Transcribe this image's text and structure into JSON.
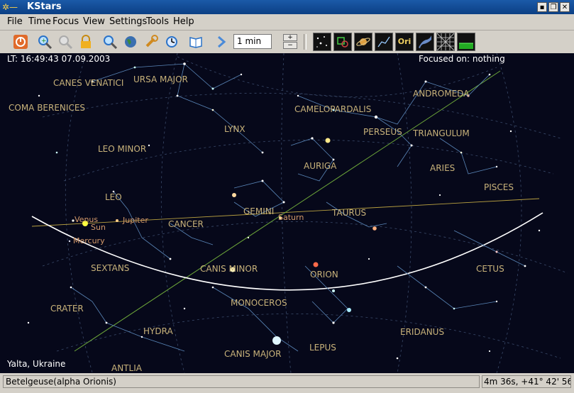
{
  "window": {
    "title": "KStars"
  },
  "menubar": {
    "items": [
      "File",
      "Time",
      "Focus",
      "View",
      "Settings",
      "Tools",
      "Help"
    ]
  },
  "toolbar": {
    "time_step_value": "1 min",
    "spin_up": "+",
    "spin_down": "−",
    "dark_buttons": [
      "stars-icon",
      "deep-sky-icon",
      "solar-system-icon",
      "constellation-lines-icon",
      "constellation-names-icon",
      "milky-way-icon",
      "coordinate-grid-icon",
      "ground-icon"
    ],
    "names_button_label": "Ori"
  },
  "sky": {
    "local_time": "LT: 16:49:43   07.09.2003",
    "focus_text": "Focused on: nothing",
    "location": "Yalta, Ukraine",
    "constellations": [
      "CANES VENATICI",
      "URSA MAJOR",
      "COMA BERENICES",
      "LYNX",
      "CAMELOPARDALIS",
      "ANDROMEDA",
      "PERSEUS",
      "TRIANGULUM",
      "LEO MINOR",
      "AURIGA",
      "ARIES",
      "PISCES",
      "LEO",
      "GEMINI",
      "TAURUS",
      "CANCER",
      "SEXTANS",
      "CANIS MINOR",
      "ORION",
      "CETUS",
      "CRATER",
      "MONOCEROS",
      "HYDRA",
      "ERIDANUS",
      "LEPUS",
      "CANIS MAJOR",
      "ANTLIA"
    ],
    "planets": [
      "Venus",
      "Jupiter",
      "Sun",
      "Mercury",
      "Saturn"
    ]
  },
  "statusbar": {
    "object_name": "Betelgeuse(alpha Orionis)",
    "coordinates": "4m 36s,  +41° 42' 56\""
  }
}
